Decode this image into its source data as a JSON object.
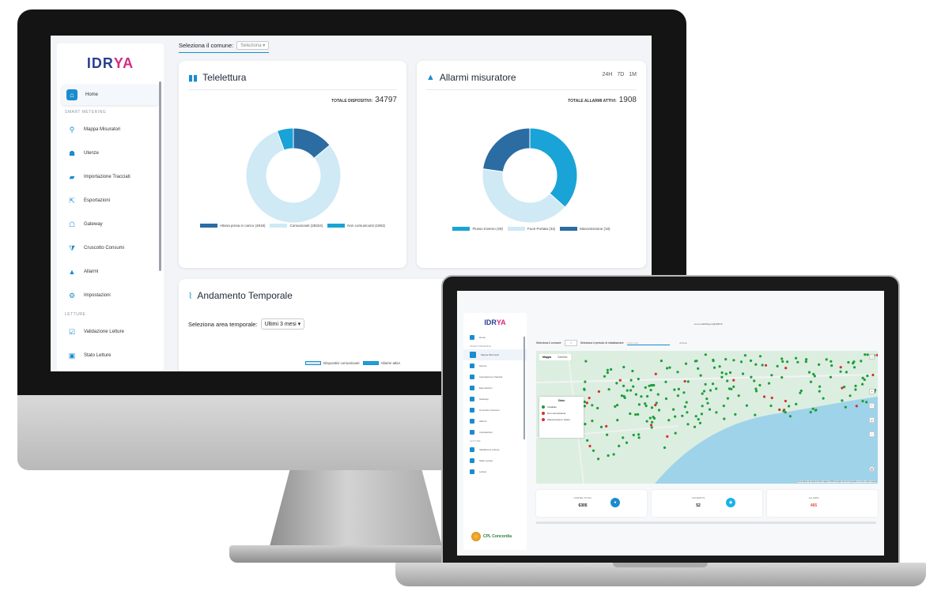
{
  "desktop": {
    "brand": {
      "logo_main": "IDR",
      "logo_accent": "YA"
    },
    "sidebar": {
      "home_label": "Home",
      "section_smart": "SMART METERING",
      "items": [
        {
          "label": "Mappa Misuratori",
          "icon": "map-pin-icon"
        },
        {
          "label": "Utenze",
          "icon": "users-icon"
        },
        {
          "label": "Importazione Tracciati",
          "icon": "folder-icon"
        },
        {
          "label": "Esportazioni",
          "icon": "export-icon"
        },
        {
          "label": "Gateway",
          "icon": "gateway-icon"
        },
        {
          "label": "Cruscotto Consumi",
          "icon": "filter-icon"
        },
        {
          "label": "Allarmi",
          "icon": "alarm-icon"
        },
        {
          "label": "Impostazioni",
          "icon": "settings-icon"
        }
      ],
      "section_letture": "LETTURE",
      "items_letture": [
        {
          "label": "Validazione Letture",
          "icon": "check-icon"
        },
        {
          "label": "Stato Letture",
          "icon": "status-icon"
        }
      ]
    },
    "topbar": {
      "label": "Seleziona il comune:",
      "select_placeholder": "Seleziona ▾"
    },
    "telelettura": {
      "title": "Telelettura",
      "total_label": "TOTALE DISPOSITIVI:",
      "total_value": "34797",
      "legend": [
        {
          "label": "Attesa presa in carico (4919)",
          "color": "#2b6ca3"
        },
        {
          "label": "Comunicanti (28324)",
          "color": "#cfe9f5"
        },
        {
          "label": "Non comunicanti (1963)",
          "color": "#1aa3d6"
        }
      ],
      "slices": [
        4919,
        28324,
        1963
      ]
    },
    "allarmi": {
      "title": "Allarmi misuratore",
      "total_label": "TOTALE ALLARMI ATTIVI:",
      "total_value": "1908",
      "ranges": [
        "24H",
        "7D",
        "1M"
      ],
      "legend": [
        {
          "label": "Flusso Inverso (29)",
          "color": "#1aa3d6"
        },
        {
          "label": "Fuori Portata (32)",
          "color": "#cfe9f5"
        },
        {
          "label": "Manomissione (18)",
          "color": "#2b6ca3"
        }
      ],
      "slices": [
        29,
        32,
        18
      ]
    },
    "andamento": {
      "title": "Andamento Temporale",
      "area_label": "Seleziona area temporale:",
      "area_value": "Ultimi 3 mesi",
      "legend": [
        "Dispositivi comunicanti",
        "Allarmi attivi"
      ]
    }
  },
  "laptop": {
    "brand": {
      "logo_main": "IDR",
      "logo_accent": "YA"
    },
    "user": "ecu.saddhugo.it@IDRYA",
    "filters": {
      "comune_label": "Seleziona il comune:",
      "period_label": "Seleziona il periodo di installazione:",
      "date_placeholder": "Data inizio",
      "clear_label": "Azzera"
    },
    "sidebar": {
      "items": [
        "Home",
        "Mappa Misuratori",
        "Utenze",
        "Importazione Tracciati",
        "Esportazioni",
        "Gateway",
        "Cruscotto Consumi",
        "Allarmi",
        "Impostazioni"
      ],
      "section_smart": "SMART METERING",
      "section_letture": "LETTURE",
      "items_letture": [
        "Validazione Letture",
        "Stato Letture",
        "Letture"
      ]
    },
    "map": {
      "tab_map": "Mappa",
      "tab_sat": "Satellite",
      "legend_title": "Stato",
      "legend": [
        {
          "label": "Installato",
          "color": "#1e9e3c"
        },
        {
          "label": "Non comunicante",
          "color": "#d63030"
        },
        {
          "label": "Attesa presa in carico",
          "color": "#d63030"
        }
      ],
      "attribution": "Scorciatoie da tastiera   Dati mappa ©2023 Google   Termini   Segnala un errore nella mappa"
    },
    "stats": [
      {
        "label": "UTENZE TOTALI",
        "value": "6305",
        "color": "#1a8ccf"
      },
      {
        "label": "GATEWAYS",
        "value": "52",
        "color": "#19b3e6"
      },
      {
        "label": "ALLARMI",
        "value": "465",
        "color": "#e0533a"
      }
    ],
    "partner": "CPL Concordia"
  }
}
